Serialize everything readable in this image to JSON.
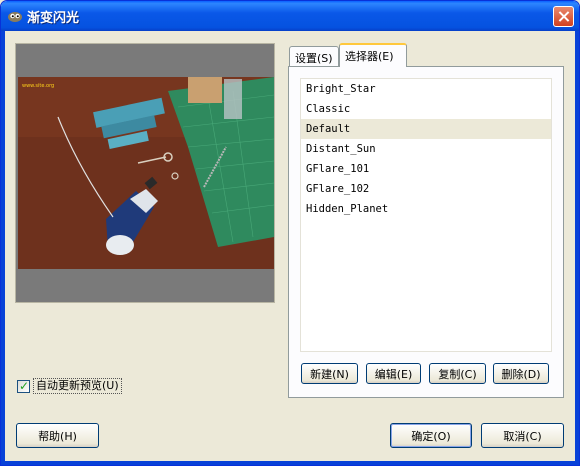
{
  "window": {
    "title": "渐变闪光",
    "title_icon": "gimp-icon",
    "close_icon": "close-icon"
  },
  "tabs": [
    {
      "label": "设置(S)",
      "active": false
    },
    {
      "label": "选择器(E)",
      "active": true
    }
  ],
  "preview": {
    "image_caption": "ThePicture  www.site.org",
    "description_icon": "photo-preview"
  },
  "gflare_list": {
    "items": [
      "Bright_Star",
      "Classic",
      "Default",
      "Distant_Sun",
      "GFlare_101",
      "GFlare_102",
      "Hidden_Planet"
    ],
    "selected": "Default"
  },
  "list_buttons": {
    "new": "新建(N)",
    "edit": "编辑(E)",
    "copy": "复制(C)",
    "delete": "删除(D)"
  },
  "auto_preview": {
    "label": "自动更新预览(U)",
    "checked": true
  },
  "dialog_buttons": {
    "help": "帮助(H)",
    "ok": "确定(O)",
    "cancel": "取消(C)"
  },
  "colors": {
    "titlebar": "#0a58e8",
    "dialog_bg": "#ece9d8",
    "active_tab_accent": "#ffc83c",
    "selected_row": "#ece9d8",
    "checkmark": "#21a121"
  }
}
